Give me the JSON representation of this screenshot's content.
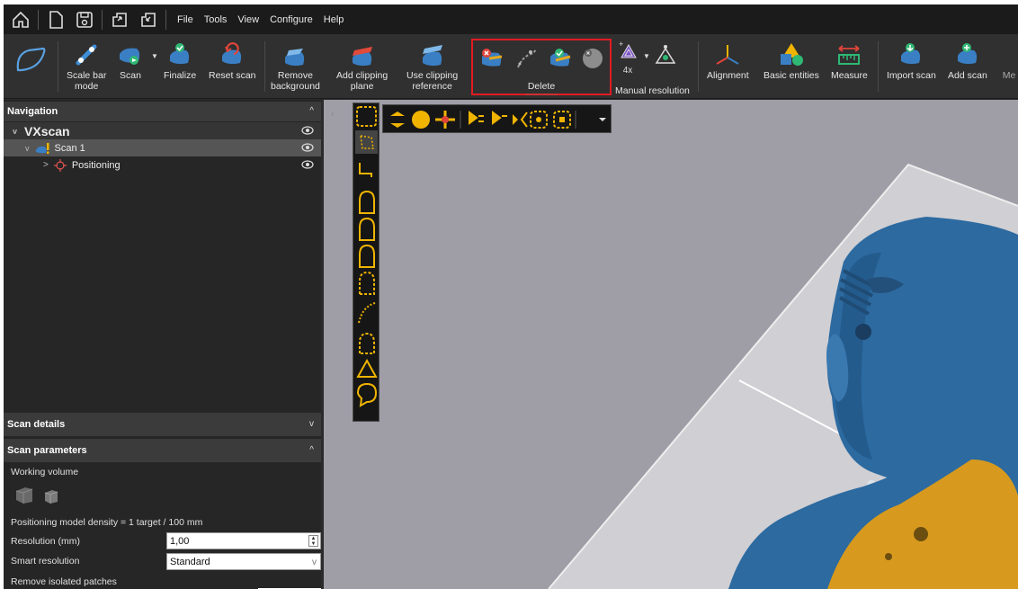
{
  "menubar": {
    "quick_icons": [
      "home-icon",
      "new-file-icon",
      "save-icon",
      "export-icon",
      "import-icon"
    ],
    "items": [
      "File",
      "Tools",
      "View",
      "Configure",
      "Help"
    ]
  },
  "ribbon": {
    "buttons": [
      {
        "label": "Scale bar\nmode",
        "icon": "scale-bar-icon"
      },
      {
        "label": "Scan",
        "icon": "scan-icon"
      },
      {
        "label": "Finalize",
        "icon": "finalize-icon"
      },
      {
        "label": "Reset scan",
        "icon": "reset-scan-icon"
      },
      {
        "label": "Remove\nbackground",
        "icon": "remove-background-icon"
      },
      {
        "label": "Add clipping\nplane",
        "icon": "clipping-plane-icon"
      },
      {
        "label": "Use clipping\nreference",
        "icon": "clipping-reference-icon"
      }
    ],
    "delete_group": {
      "label": "Delete",
      "tools": [
        "delete-selection-icon",
        "delete-isolated-icon",
        "delete-validated-icon",
        "delete-all-icon"
      ]
    },
    "resolution": {
      "zoom": "4x",
      "label": "Manual resolution"
    },
    "right_buttons": [
      {
        "label": "Alignment",
        "icon": "alignment-icon"
      },
      {
        "label": "Basic entities",
        "icon": "basic-entities-icon"
      },
      {
        "label": "Measure",
        "icon": "measure-icon"
      },
      {
        "label": "Import scan",
        "icon": "import-scan-icon"
      },
      {
        "label": "Add scan",
        "icon": "add-scan-icon"
      },
      {
        "label": "Me",
        "icon": "more-icon"
      }
    ]
  },
  "navigation": {
    "title": "Navigation",
    "root": "VXscan",
    "scan": "Scan 1",
    "child": "Positioning"
  },
  "scan_details": {
    "title": "Scan details"
  },
  "scan_parameters": {
    "title": "Scan parameters",
    "working_volume": "Working volume",
    "density": "Positioning model density = 1 target / 100 mm",
    "resolution_label": "Resolution (mm)",
    "resolution_value": "1,00",
    "smart_label": "Smart resolution",
    "smart_value": "Standard",
    "isolated_label": "Remove isolated patches"
  },
  "colors": {
    "accent_yellow": "#f0b400",
    "model_blue": "#2c6aa0",
    "handle_gold": "#d79a1e",
    "highlight_red": "#e21b22"
  }
}
